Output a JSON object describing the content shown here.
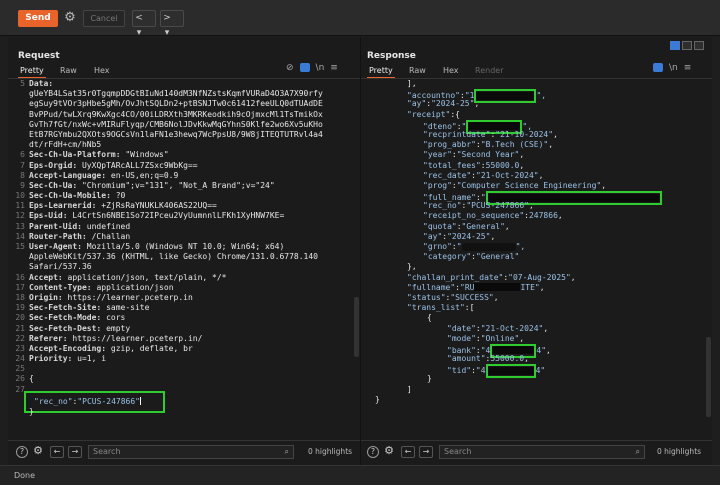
{
  "toolbar": {
    "send_label": "Send",
    "cancel_label": "Cancel",
    "back_glyph": "<",
    "back_drop": "▾",
    "fwd_glyph": ">",
    "fwd_drop": "▾"
  },
  "request": {
    "title": "Request",
    "tabs": [
      "Pretty",
      "Raw",
      "Hex"
    ],
    "lines": [
      {
        "n": "5",
        "k": "Data:",
        "v": ""
      },
      {
        "n": "",
        "c": "gUeYB4LSat35r0TgqmpDDGtBIuNd140dM3NfNZstsKqmfVURaD4O3A7X90rfy"
      },
      {
        "n": "",
        "c": "egSuy9tVOr3pHbe5gMh/OvJhtSQLDn2+ptBSNJTw0c61412feeULQ0dTUAdDE"
      },
      {
        "n": "",
        "c": "BvPPud/twLXrq9KwXgc4CO/00iLDRXth3MKRKeodkih9cOjmxcMl1TsTmikOx"
      },
      {
        "n": "",
        "c": "GvTh7fGt/nxWc+vMIRuFlyqp/CMB6NolJDvKkwMqGYhnS0Klfe2wo6Xv5uKHo"
      },
      {
        "n": "",
        "c": "EtB7RGYmbu2QXOts9OGCsVn1laFN1e3hewq7WcPpsU8/9W8jITEQTUTRvl4a4"
      },
      {
        "n": "",
        "c": "dt/rFdH+cm/hNb5"
      },
      {
        "n": "6",
        "k": "Sec-Ch-Ua-Platform:",
        "v": " \"Windows\""
      },
      {
        "n": "7",
        "k": "Eps-Orgid:",
        "v": " UyXQpTARcALL7ZSxc9WbKg=="
      },
      {
        "n": "8",
        "k": "Accept-Language:",
        "v": " en-US,en;q=0.9"
      },
      {
        "n": "9",
        "k": "Sec-Ch-Ua:",
        "v": " \"Chromium\";v=\"131\", \"Not_A Brand\";v=\"24\""
      },
      {
        "n": "10",
        "k": "Sec-Ch-Ua-Mobile:",
        "v": " ?0"
      },
      {
        "n": "11",
        "k": "Eps-Learnerid:",
        "v": " +ZjRsRaYNUKLK406AS22UQ=="
      },
      {
        "n": "12",
        "k": "Eps-Uid:",
        "v": " L4CrtSn6NBE1So72IPceu2VyUumnnlLFKh1XyHNW7KE="
      },
      {
        "n": "13",
        "k": "Parent-Uid:",
        "v": " undefined"
      },
      {
        "n": "14",
        "k": "Router-Path:",
        "v": " /Challan"
      },
      {
        "n": "15",
        "k": "User-Agent:",
        "v": " Mozilla/5.0 (Windows NT 10.0; Win64; x64)"
      },
      {
        "n": "",
        "c": "AppleWebKit/537.36 (KHTML, like Gecko) Chrome/131.0.6778.140"
      },
      {
        "n": "",
        "c": "Safari/537.36"
      },
      {
        "n": "16",
        "k": "Accept:",
        "v": " application/json, text/plain, */*"
      },
      {
        "n": "17",
        "k": "Content-Type:",
        "v": " application/json"
      },
      {
        "n": "18",
        "k": "Origin:",
        "v": " https://learner.pceterp.in"
      },
      {
        "n": "19",
        "k": "Sec-Fetch-Site:",
        "v": " same-site"
      },
      {
        "n": "20",
        "k": "Sec-Fetch-Mode:",
        "v": " cors"
      },
      {
        "n": "21",
        "k": "Sec-Fetch-Dest:",
        "v": " empty"
      },
      {
        "n": "22",
        "k": "Referer:",
        "v": " https://learner.pceterp.in/"
      },
      {
        "n": "23",
        "k": "Accept-Encoding:",
        "v": " gzip, deflate, br"
      },
      {
        "n": "24",
        "k": "Priority:",
        "v": " u=1, i"
      },
      {
        "n": "25",
        "c": ""
      },
      {
        "n": "26",
        "c": "{"
      }
    ],
    "body_key": "\"rec_no\"",
    "body_sep": ":",
    "body_val": "\"PCUS-247866\"",
    "line27": "27",
    "brace_close": "}",
    "search_placeholder": "Search",
    "highlights": "0 highlights"
  },
  "response": {
    "title": "Response",
    "tabs": [
      "Pretty",
      "Raw",
      "Hex",
      "Render"
    ],
    "l_open": "],",
    "accountno_key": "\"accountno\"",
    "accountno_pre": "\"1",
    "ay_key": "\"ay\"",
    "ay_val": "\"2024-25\"",
    "receipt_key": "\"receipt\"",
    "receipt_open": ":{",
    "dteno_key": "\"dteno\"",
    "recprintdate_key": "\"recprintdate\"",
    "recprintdate_val": "\"21-10-2024\"",
    "prog_abbr_key": "\"prog_abbr\"",
    "prog_abbr_val": "\"B.Tech (CSE)\"",
    "year_key": "\"year\"",
    "year_val": "\"Second Year\"",
    "total_fees_key": "\"total_fees\"",
    "total_fees_val": "55000.0",
    "rec_date_key": "\"rec_date\"",
    "rec_date_val": "\"21-Oct-2024\"",
    "prog_key": "\"prog\"",
    "prog_val": "\"Computer Science Engineering\"",
    "full_name_key": "\"full_name\"",
    "rec_no_key": "\"rec_no\"",
    "rec_no_val": "\"PCUS-247866\"",
    "receipt_no_sequence_key": "\"receipt_no_sequence\"",
    "receipt_no_sequence_val": "247866",
    "quota_key": "\"quota\"",
    "quota_val": "\"General\"",
    "ay2_key": "\"ay\"",
    "ay2_val": "\"2024-25\"",
    "grno_key": "\"grno\"",
    "category_key": "\"category\"",
    "category_val": "\"General\"",
    "close_brace": "},",
    "challan_key": "\"challan_print_date\"",
    "challan_val": "\"07-Aug-2025\"",
    "fullname_key": "\"fullname\"",
    "fullname_pre": "\"RU",
    "fullname_post": "ITE\"",
    "status_key": "\"status\"",
    "status_val": "\"SUCCESS\"",
    "trans_key": "\"trans_list\"",
    "trans_open": ":[",
    "t_open": "{",
    "date_key": "\"date\"",
    "date_val": "\"21-Oct-2024\"",
    "mode_key": "\"mode\"",
    "mode_val": "\"Online\"",
    "bank_key": "\"bank\"",
    "bank_pre": "\"4",
    "bank_post": "4\"",
    "amount_key": "\"amount\"",
    "amount_val": "55000.0",
    "tid_key": "\"tid\"",
    "tid_pre": "\"4",
    "tid_post": "4\"",
    "t_close": "}",
    "arr_close": "]",
    "obj_close": "}",
    "search_placeholder": "Search",
    "highlights": "0 highlights"
  },
  "status": {
    "text": "Done"
  }
}
